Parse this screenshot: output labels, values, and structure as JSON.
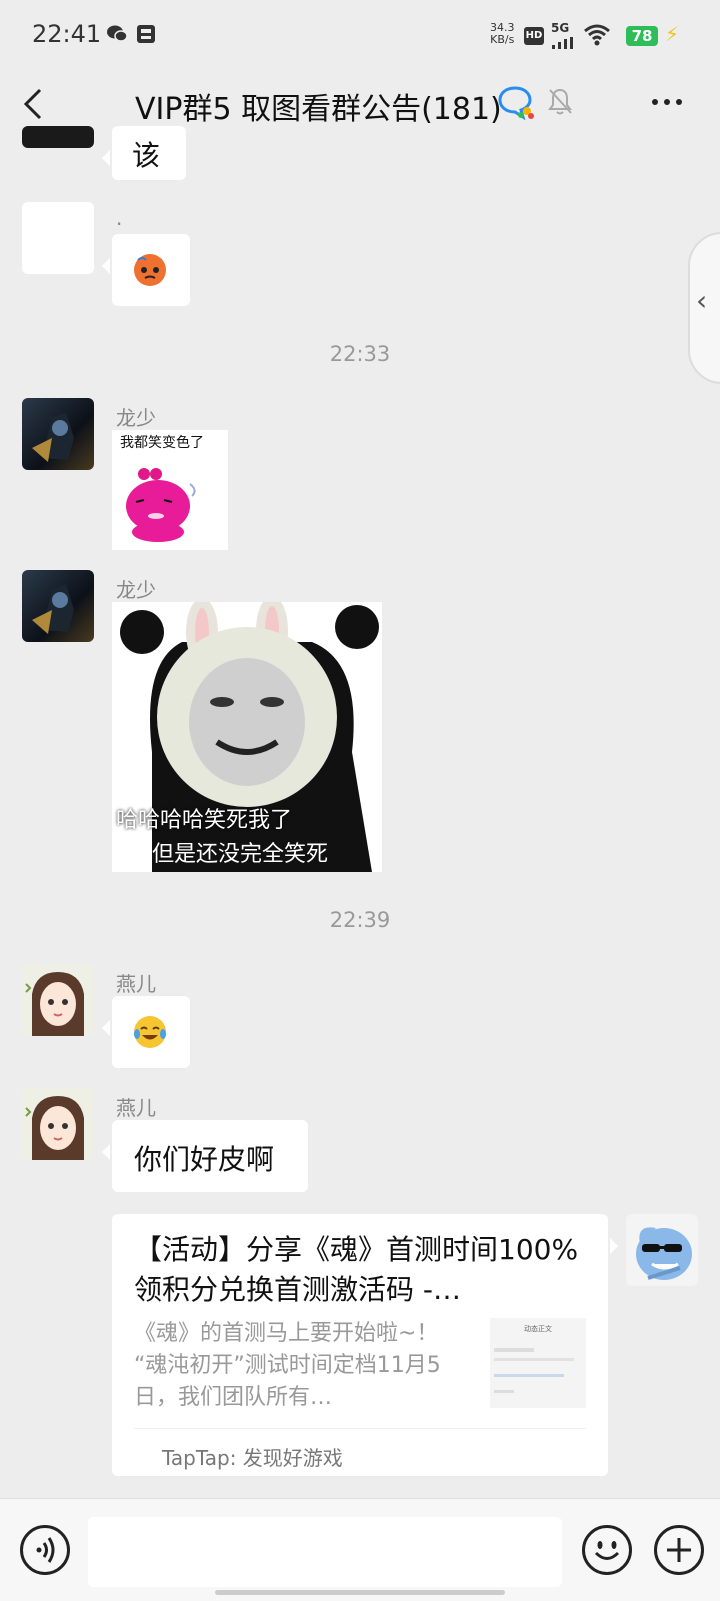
{
  "status_bar": {
    "time": "22:41",
    "net_speed_value": "34.3",
    "net_speed_unit": "KB/s",
    "hd": "HD",
    "network": "5G",
    "battery": "78"
  },
  "header": {
    "title": "VIP群5 取图看群公告(181)",
    "icons": [
      "back-icon",
      "group-chat-icon",
      "mute-bell-icon",
      "more-icon"
    ]
  },
  "messages": {
    "top_partial_text": "该",
    "dot_sender": ".",
    "time1": "22:33",
    "m1_sender": "龙少",
    "m1_sticker_caption": "我都笑变色了",
    "m2_sender": "龙少",
    "m2_sticker_line1": "哈哈哈哈笑死我了",
    "m2_sticker_line2": "但是还没完全笑死",
    "time2": "22:39",
    "m3_sender": "燕儿",
    "m4_sender": "燕儿",
    "m4_text": "你们好皮啊"
  },
  "link_card": {
    "title": "【活动】分享《魂》首测时间100%领积分兑换首测激活码 -…",
    "desc": "《魂》的首测马上要开始啦~！ “魂沌初开”测试时间定档11月5日，我们团队所有…",
    "source": "TapTap: 发现好游戏",
    "thumb_title": "动态正文"
  },
  "input_bar": {
    "icons": [
      "voice-icon",
      "emoji-icon",
      "plus-icon"
    ]
  },
  "colors": {
    "background": "#ededed",
    "bubble": "#ffffff",
    "battery": "#2ebd59"
  }
}
